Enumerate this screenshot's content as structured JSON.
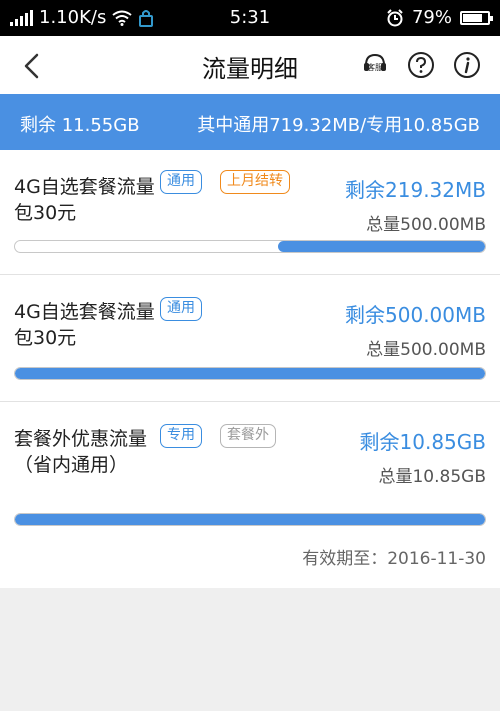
{
  "status_bar": {
    "network_speed": "1.10K/s",
    "time": "5:31",
    "battery": "79%",
    "battery_level": 0.79,
    "icons": [
      "signal-icon",
      "wifi-icon",
      "vpn-icon",
      "alarm-icon",
      "battery-icon"
    ]
  },
  "navbar": {
    "title": "流量明细",
    "icons": [
      "back-arrow-icon",
      "customer-service-icon",
      "help-icon",
      "info-icon"
    ],
    "service_label": "客服"
  },
  "summary": {
    "remaining": "剩余 11.55GB",
    "detail": "其中通用719.32MB/专用10.85GB"
  },
  "packages": [
    {
      "name": "4G自选套餐流量包30元",
      "tags": [
        {
          "text": "通用",
          "style": "blue"
        },
        {
          "text": "上月结转",
          "style": "orange"
        }
      ],
      "remaining": "剩余219.32MB",
      "total": "总量500.00MB",
      "remaining_fraction": 0.44
    },
    {
      "name": "4G自选套餐流量包30元",
      "tags": [
        {
          "text": "通用",
          "style": "blue"
        }
      ],
      "remaining": "剩余500.00MB",
      "total": "总量500.00MB",
      "remaining_fraction": 1.0
    },
    {
      "name": "套餐外优惠流量（省内通用）",
      "tags": [
        {
          "text": "专用",
          "style": "blue"
        },
        {
          "text": "套餐外",
          "style": "gray"
        }
      ],
      "remaining": "剩余10.85GB",
      "total": "总量10.85GB",
      "remaining_fraction": 1.0
    }
  ],
  "expiry": "有效期至：2016-11-30",
  "colors": {
    "accent": "#4a90e2",
    "tag_orange": "#f08a1c",
    "status_bar_bg": "#000000"
  }
}
